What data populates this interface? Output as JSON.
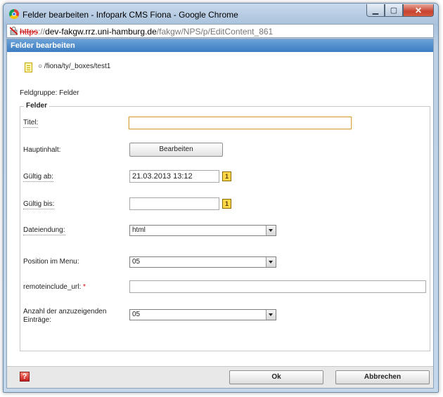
{
  "window": {
    "title": "Felder bearbeiten - Infopark CMS Fiona - Google Chrome",
    "minimize_glyph": "▁",
    "maximize_glyph": "▢",
    "close_glyph": "✕"
  },
  "address_bar": {
    "scheme": "https",
    "separator": "://",
    "host": "dev-fakgw.rrz.uni-hamburg.de",
    "path": "/fakgw/NPS/p/EditContent_861"
  },
  "panel": {
    "header": "Felder bearbeiten",
    "path": "○ /fiona/ty/_boxes/test1",
    "feldgruppe_label": "Feldgruppe:",
    "feldgruppe_value": "Felder"
  },
  "fieldset": {
    "legend": "Felder",
    "fields": {
      "titel": {
        "label": "Titel:",
        "value": ""
      },
      "hauptinhalt": {
        "label": "Hauptinhalt:",
        "button": "Bearbeiten"
      },
      "gueltig_ab": {
        "label": "Gültig ab:",
        "value": "21.03.2013 13:12"
      },
      "gueltig_bis": {
        "label": "Gültig bis:",
        "value": ""
      },
      "dateiendung": {
        "label": "Dateiendung:",
        "selected": "html"
      },
      "position": {
        "label": "Position im Menu:",
        "selected": "05"
      },
      "remoteinclude": {
        "label": "remoteinclude_url:",
        "required_mark": "*",
        "value": ""
      },
      "anzahl": {
        "label_line1": "Anzahl der anzuzeigenden",
        "label_line2": "Einträge:",
        "selected": "05"
      }
    },
    "calendar_glyph": "1"
  },
  "footer": {
    "help_glyph": "?",
    "ok": "Ok",
    "cancel": "Abbrechen"
  }
}
